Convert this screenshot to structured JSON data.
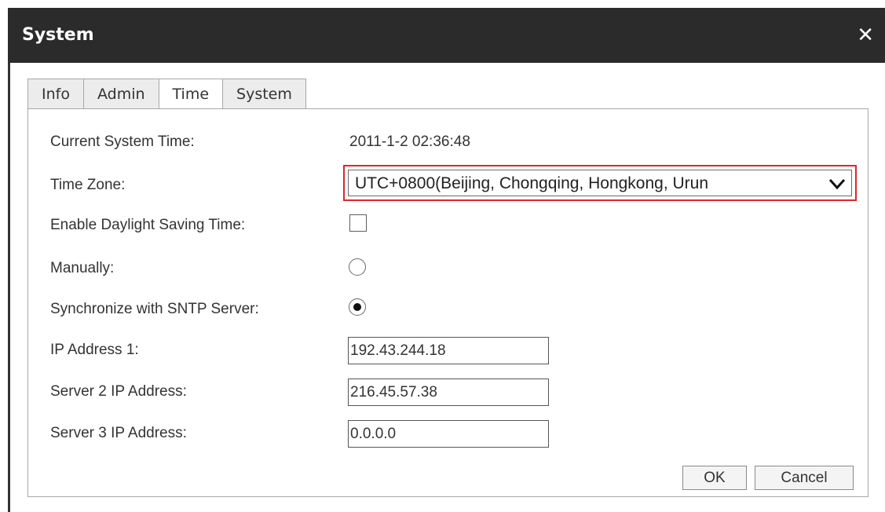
{
  "window": {
    "title": "System",
    "close_icon": "close-icon"
  },
  "tabs": [
    {
      "label": "Info",
      "active": false
    },
    {
      "label": "Admin",
      "active": false
    },
    {
      "label": "Time",
      "active": true
    },
    {
      "label": "System",
      "active": false
    }
  ],
  "form": {
    "current_time": {
      "label": "Current System Time:",
      "value": "2011-1-2 02:36:48"
    },
    "time_zone": {
      "label": "Time Zone:",
      "value": "UTC+0800(Beijing, Chongqing, Hongkong, Urun"
    },
    "dst": {
      "label": "Enable Daylight Saving Time:",
      "checked": false
    },
    "manually": {
      "label": "Manually:",
      "selected": false
    },
    "sntp": {
      "label": "Synchronize with SNTP Server:",
      "selected": true
    },
    "ip1": {
      "label": "IP Address 1:",
      "value": "192.43.244.18"
    },
    "ip2": {
      "label": "Server 2 IP Address:",
      "value": "216.45.57.38"
    },
    "ip3": {
      "label": "Server 3 IP Address:",
      "value": "0.0.0.0"
    }
  },
  "buttons": {
    "ok": "OK",
    "cancel": "Cancel"
  },
  "colors": {
    "titlebar": "#2b2b2b",
    "highlight_border": "#e0242b"
  }
}
